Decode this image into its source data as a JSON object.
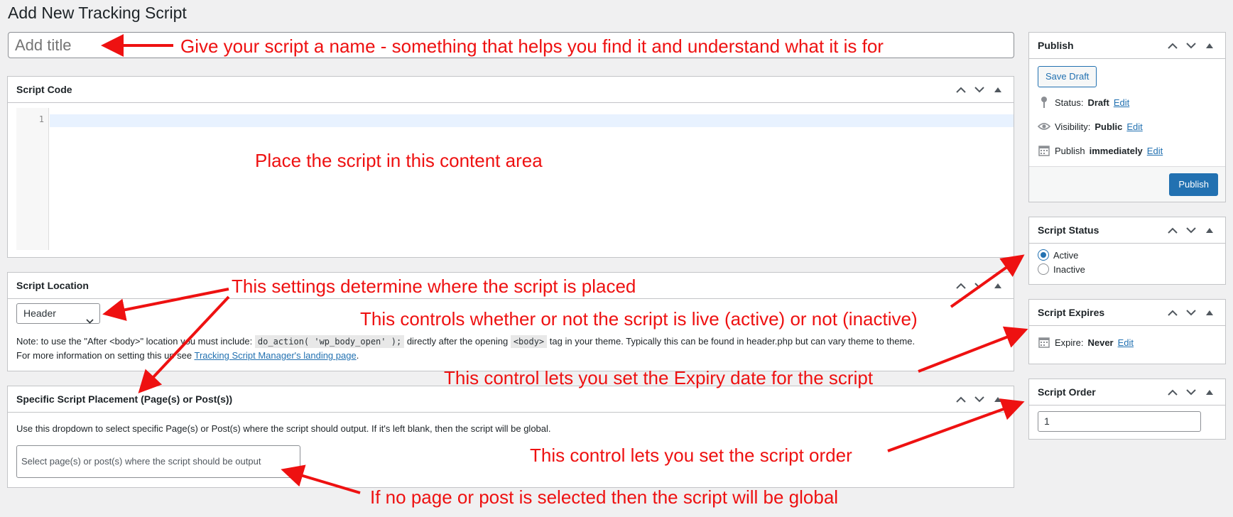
{
  "page": {
    "title": "Add New Tracking Script"
  },
  "title_field": {
    "placeholder": "Add title"
  },
  "script_code": {
    "title": "Script Code",
    "line_number": "1"
  },
  "script_location": {
    "title": "Script Location",
    "selected": "Header",
    "note_1": "Note: to use the \"After <body>\" location you must include:",
    "code_1": "do_action( 'wp_body_open' );",
    "note_2": "directly after the opening",
    "code_2": "<body>",
    "note_3": "tag in your theme. Typically this can be found in header.php but can vary theme to theme.",
    "note_4": "For more information on setting this up see",
    "link": "Tracking Script Manager's landing page",
    "note_5": "."
  },
  "specific_placement": {
    "title": "Specific Script Placement (Page(s) or Post(s))",
    "description": "Use this dropdown to select specific Page(s) or Post(s) where the script should output. If it's left blank, then the script will be global.",
    "placeholder": "Select page(s) or post(s) where the script should be output"
  },
  "publish": {
    "title": "Publish",
    "save_draft": "Save Draft",
    "status_label": "Status:",
    "status_value": "Draft",
    "visibility_label": "Visibility:",
    "visibility_value": "Public",
    "publish_label": "Publish",
    "publish_value": "immediately",
    "edit": "Edit",
    "publish_button": "Publish"
  },
  "script_status": {
    "title": "Script Status",
    "options": [
      "Active",
      "Inactive"
    ],
    "selected": "Active"
  },
  "script_expires": {
    "title": "Script Expires",
    "label": "Expire:",
    "value": "Never",
    "edit": "Edit"
  },
  "script_order": {
    "title": "Script Order",
    "value": "1"
  },
  "annotations": {
    "title_hint": "Give your script a name - something that helps you find it and understand what it is for",
    "content_hint": "Place the script in this content area",
    "location_hint": "This settings determine where the script is placed",
    "status_hint": "This controls whether or not the script is live (active) or not (inactive)",
    "expiry_hint": "This control lets you set the Expiry date for the script",
    "order_hint": "This control lets you set the script order",
    "global_hint": "If no page or post is selected then the script will be global"
  },
  "colors": {
    "annotation": "#ee1111",
    "primary": "#2271b1"
  }
}
